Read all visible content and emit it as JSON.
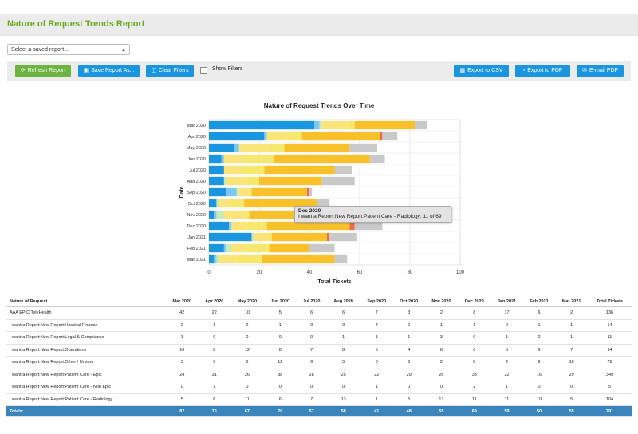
{
  "header": {
    "title": "Nature of Request Trends Report"
  },
  "saved_report": {
    "placeholder": "Select a saved report..."
  },
  "toolbar": {
    "refresh": "Refresh Report",
    "save_as": "Save Report As...",
    "clear_filters": "Clear Filters",
    "show_filters": "Show Filters",
    "export_csv": "Export to CSV",
    "export_pdf": "Export to PDF",
    "email_pdf": "E-mail PDF"
  },
  "chart_data": {
    "type": "bar",
    "orientation": "horizontal",
    "stacked": true,
    "title": "Nature of Request Trends Over Time",
    "xlabel": "Total Tickets",
    "ylabel": "Date",
    "xlim": [
      0,
      100
    ],
    "xticks": [
      0,
      20,
      40,
      60,
      80,
      100
    ],
    "grid": true,
    "categories": [
      "Mar 2020",
      "Apr 2020",
      "May 2020",
      "Jun 2020",
      "Jul 2020",
      "Aug 2020",
      "Sep 2020",
      "Oct 2020",
      "Nov 2020",
      "Dec 2020",
      "Jan 2021",
      "Feb 2021",
      "Mar 2021"
    ],
    "series": [
      {
        "name": "AAA EPIC TeleHealth",
        "color": "#1a95e0",
        "values": [
          42,
          22,
          10,
          5,
          6,
          6,
          7,
          3,
          2,
          8,
          17,
          6,
          2
        ]
      },
      {
        "name": "I want a Report:New Report:Hospital Finance",
        "color": "#7cc8f2",
        "values": [
          2,
          1,
          2,
          1,
          0,
          0,
          4,
          0,
          1,
          1,
          0,
          1,
          1
        ]
      },
      {
        "name": "I want a Report:New Report:Legal & Compliance",
        "color": "#c6ecb6",
        "values": [
          1,
          0,
          0,
          0,
          0,
          1,
          1,
          1,
          3,
          0,
          1,
          2,
          1
        ]
      },
      {
        "name": "I want a Report:New Report:Operations",
        "color": "#fbe47a",
        "values": [
          10,
          8,
          12,
          8,
          7,
          8,
          5,
          4,
          8,
          6,
          5,
          6,
          7
        ]
      },
      {
        "name": "I want a Report:New Report:Other / Unsure",
        "color": "#f5e86c",
        "values": [
          3,
          6,
          6,
          12,
          9,
          5,
          0,
          6,
          2,
          8,
          2,
          9,
          10
        ]
      },
      {
        "name": "I want a Report:New Report:Patient Care - Epic",
        "color": "#f8c12a",
        "values": [
          24,
          31,
          26,
          38,
          28,
          25,
          22,
          29,
          26,
          33,
          22,
          16,
          29
        ]
      },
      {
        "name": "I want a Report:New Report:Patient Care - Non Epic",
        "color": "#ef6a4a",
        "values": [
          0,
          1,
          0,
          0,
          0,
          0,
          1,
          0,
          0,
          2,
          1,
          0,
          0
        ]
      },
      {
        "name": "I want a Report:New Report:Patient Care - Radiology",
        "color": "#c9c9c9",
        "values": [
          5,
          6,
          11,
          6,
          7,
          13,
          1,
          5,
          13,
          11,
          11,
          10,
          5
        ]
      }
    ]
  },
  "tooltip": {
    "title": "Dec 2020",
    "text": "I want a Report:New Report:Patient Care - Radiology: 11 of 69"
  },
  "table": {
    "headers": [
      "Nature of Request",
      "Mar 2020",
      "Apr 2020",
      "May 2020",
      "Jun 2020",
      "Jul 2020",
      "Aug 2020",
      "Sep 2020",
      "Oct 2020",
      "Nov 2020",
      "Dec 2020",
      "Jan 2021",
      "Feb 2021",
      "Mar 2021",
      "Total Tickets"
    ],
    "rows": [
      [
        "AAA EPIC TeleHealth",
        "42",
        "22",
        "10",
        "5",
        "6",
        "6",
        "7",
        "3",
        "2",
        "8",
        "17",
        "6",
        "2",
        "136"
      ],
      [
        "I want a Report:New Report:Hospital Finance",
        "2",
        "1",
        "2",
        "1",
        "0",
        "0",
        "4",
        "0",
        "1",
        "1",
        "0",
        "1",
        "1",
        "14"
      ],
      [
        "I want a Report:New Report:Legal & Compliance",
        "1",
        "0",
        "0",
        "0",
        "0",
        "1",
        "1",
        "1",
        "3",
        "0",
        "1",
        "2",
        "1",
        "11"
      ],
      [
        "I want a Report:New Report:Operations",
        "10",
        "8",
        "12",
        "8",
        "7",
        "8",
        "5",
        "4",
        "8",
        "6",
        "5",
        "6",
        "7",
        "94"
      ],
      [
        "I want a Report:New Report:Other / Unsure",
        "3",
        "6",
        "6",
        "12",
        "9",
        "5",
        "0",
        "6",
        "2",
        "8",
        "2",
        "9",
        "10",
        "78"
      ],
      [
        "I want a Report:New Report:Patient Care - Epic",
        "24",
        "31",
        "26",
        "38",
        "28",
        "25",
        "22",
        "29",
        "26",
        "33",
        "22",
        "16",
        "29",
        "349"
      ],
      [
        "I want a Report:New Report:Patient Care - Non Epic",
        "0",
        "1",
        "0",
        "0",
        "0",
        "0",
        "1",
        "0",
        "0",
        "2",
        "1",
        "0",
        "0",
        "5"
      ],
      [
        "I want a Report:New Report:Patient Care - Radiology",
        "5",
        "6",
        "11",
        "6",
        "7",
        "13",
        "1",
        "5",
        "13",
        "11",
        "11",
        "10",
        "5",
        "104"
      ]
    ],
    "totals": [
      "Totals:",
      "87",
      "75",
      "67",
      "70",
      "57",
      "58",
      "41",
      "48",
      "55",
      "69",
      "59",
      "50",
      "55",
      "791"
    ]
  }
}
